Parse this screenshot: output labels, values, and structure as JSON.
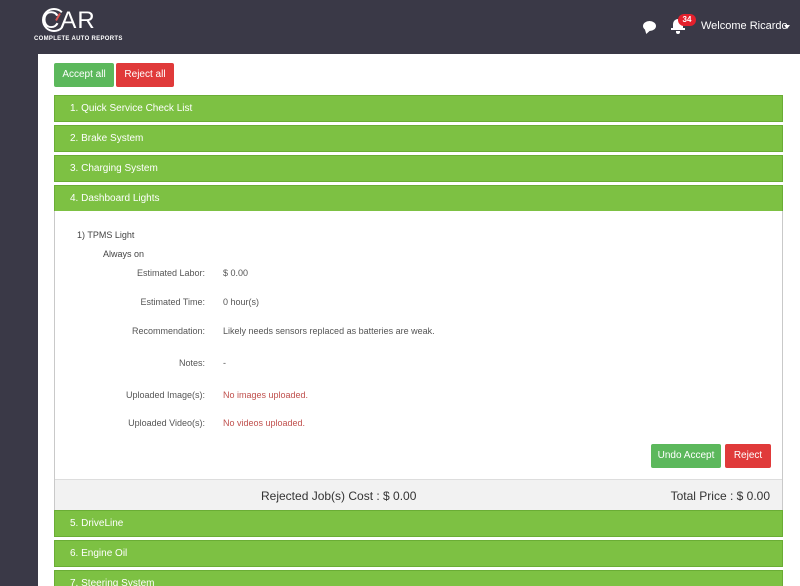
{
  "header": {
    "logo_text": "CAR",
    "logo_sub": "COMPLETE AUTO REPORTS",
    "notification_count": "34",
    "welcome": "Welcome Ricardo"
  },
  "actions": {
    "accept_all": "Accept all",
    "reject_all": "Reject all"
  },
  "sections": [
    "1. Quick Service Check List",
    "2. Brake System",
    "3. Charging System",
    "4. Dashboard Lights",
    "5. DriveLine",
    "6. Engine Oil",
    "7. Steering System"
  ],
  "item": {
    "title": "1) TPMS Light",
    "status": "Always on",
    "rows": [
      {
        "label": "Estimated Labor:",
        "value": "$ 0.00"
      },
      {
        "label": "Estimated Time:",
        "value": "0 hour(s)"
      },
      {
        "label": "Recommendation:",
        "value": "Likely needs sensors replaced as batteries are weak."
      },
      {
        "label": "Notes:",
        "value": "-"
      },
      {
        "label": "Uploaded Image(s):",
        "value": "No images uploaded."
      },
      {
        "label": "Uploaded Video(s):",
        "value": "No videos uploaded."
      }
    ],
    "undo_accept": "Undo Accept",
    "reject": "Reject"
  },
  "footer": {
    "rejected_cost": "Rejected Job(s) Cost : $ 0.00",
    "total_price": "Total Price : $ 0.00"
  },
  "colors": {
    "header_bg": "#3a3947",
    "section_green": "#7dc143",
    "accept_green": "#5cb85c",
    "reject_red": "#e03a3a"
  }
}
